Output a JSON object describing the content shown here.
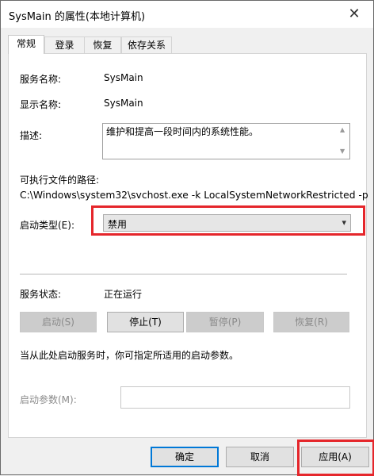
{
  "window": {
    "title": "SysMain 的属性(本地计算机)",
    "close_glyph": "✕"
  },
  "tabs": [
    "常规",
    "登录",
    "恢复",
    "依存关系"
  ],
  "general": {
    "service_name_label": "服务名称:",
    "service_name_value": "SysMain",
    "display_name_label": "显示名称:",
    "display_name_value": "SysMain",
    "description_label": "描述:",
    "description_value": "维护和提高一段时间内的系统性能。",
    "path_label": "可执行文件的路径:",
    "path_value": "C:\\Windows\\system32\\svchost.exe -k LocalSystemNetworkRestricted -p",
    "startup_type_label": "启动类型(E):",
    "startup_type_value": "禁用",
    "status_label": "服务状态:",
    "status_value": "正在运行",
    "start_button": "启动(S)",
    "stop_button": "停止(T)",
    "pause_button": "暂停(P)",
    "resume_button": "恢复(R)",
    "hint_text": "当从此处启动服务时，你可指定所适用的启动参数。",
    "start_params_label": "启动参数(M):",
    "start_params_value": ""
  },
  "footer": {
    "ok_button": "确定",
    "cancel_button": "取消",
    "apply_button": "应用(A)"
  },
  "colors": {
    "highlight": "#e5262b",
    "default_button_border": "#0078d7"
  }
}
